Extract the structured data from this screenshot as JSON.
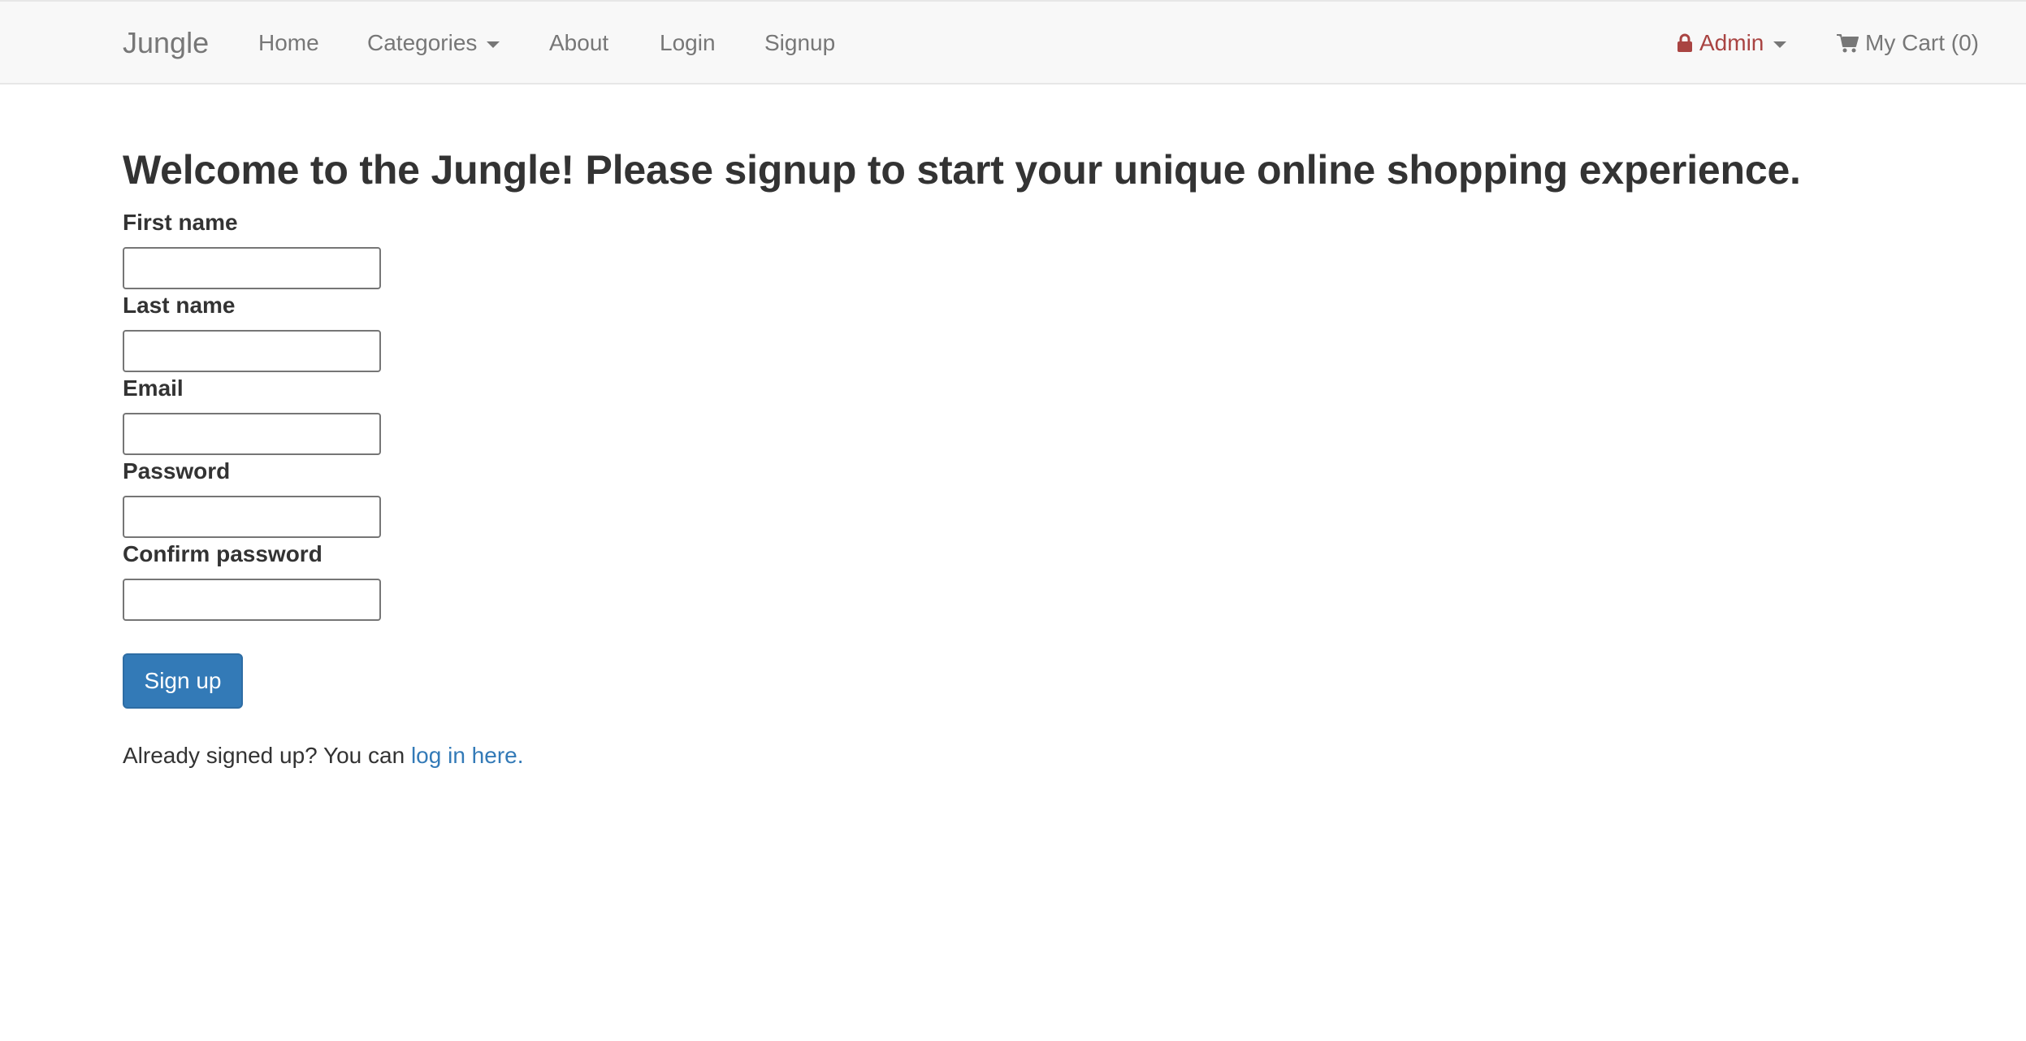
{
  "navbar": {
    "brand": "Jungle",
    "links": {
      "home": "Home",
      "categories": "Categories",
      "about": "About",
      "login": "Login",
      "signup": "Signup"
    },
    "admin": "Admin",
    "cart": "My Cart (0)"
  },
  "page": {
    "heading": "Welcome to the Jungle! Please signup to start your unique online shopping experience.",
    "form": {
      "first_name_label": "First name",
      "first_name_value": "",
      "last_name_label": "Last name",
      "last_name_value": "",
      "email_label": "Email",
      "email_value": "",
      "password_label": "Password",
      "password_value": "",
      "confirm_password_label": "Confirm password",
      "confirm_password_value": "",
      "submit_label": "Sign up"
    },
    "footer": {
      "prefix": "Already signed up? You can ",
      "link": "log in here."
    }
  },
  "colors": {
    "accent": "#337ab7",
    "admin": "#a94442",
    "navbar_bg": "#f8f8f8"
  },
  "icons": {
    "admin": "lock-icon",
    "cart": "shopping-cart-icon",
    "dropdown": "caret-down-icon"
  }
}
